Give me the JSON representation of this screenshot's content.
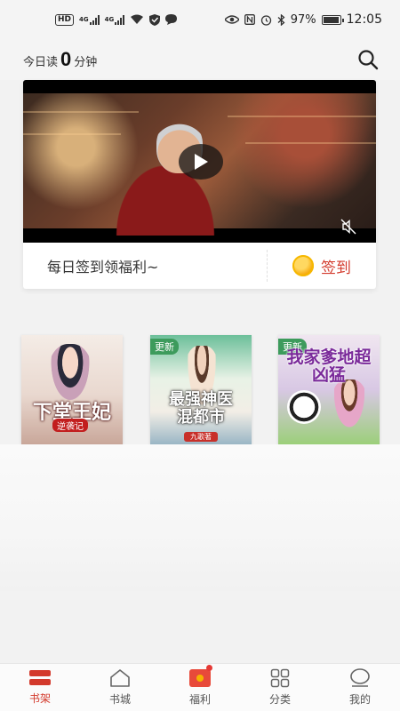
{
  "status_bar": {
    "left_icons": [
      "hd-icon",
      "signal-4g-icon",
      "signal-4g-icon",
      "wifi-icon",
      "shield-icon",
      "chat-icon"
    ],
    "hd": "HD",
    "net1": "4G",
    "net2": "4G",
    "battery": "97%",
    "time": "12:05"
  },
  "header": {
    "reading_prefix": "今日读",
    "reading_minutes": "0",
    "reading_suffix": "分钟"
  },
  "banner": {
    "signin_text": "每日签到领福利~",
    "signin_button": "签到"
  },
  "books": [
    {
      "title": "下堂王妃",
      "subtitle": "逆袭记",
      "author": "",
      "badge": ""
    },
    {
      "title": "最强神医混都市",
      "subtitle": "",
      "author": "九歌著",
      "badge": "更新"
    },
    {
      "title": "我家爹地超凶猛",
      "subtitle": "",
      "author": "",
      "badge": "更新"
    }
  ],
  "bottom_nav": [
    {
      "label": "书架",
      "icon": "bookshelf-icon",
      "active": true
    },
    {
      "label": "书城",
      "icon": "home-icon",
      "active": false
    },
    {
      "label": "福利",
      "icon": "gift-icon",
      "active": false
    },
    {
      "label": "分类",
      "icon": "grid-icon",
      "active": false
    },
    {
      "label": "我的",
      "icon": "profile-icon",
      "active": false
    }
  ],
  "colors": {
    "accent": "#d33a2c",
    "badge": "#3d9b5c",
    "coin": "#f5a300"
  }
}
